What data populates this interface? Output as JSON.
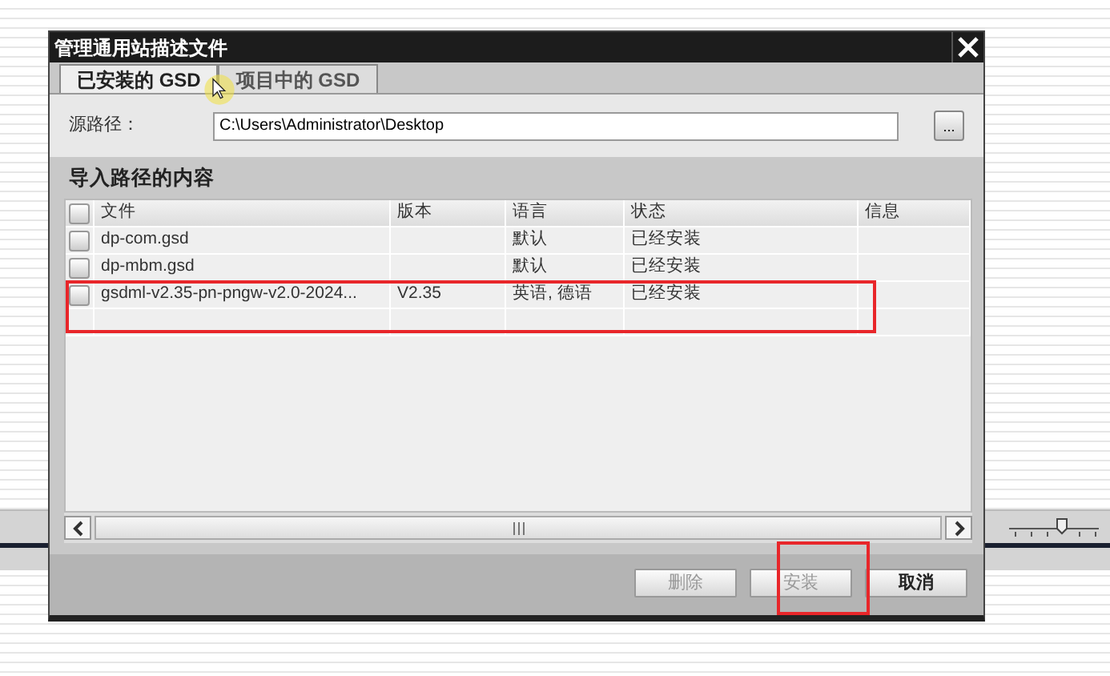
{
  "window": {
    "title": "管理通用站描述文件"
  },
  "tabs": [
    {
      "label": "已安装的 GSD",
      "selected": true
    },
    {
      "label": "项目中的 GSD",
      "selected": false
    }
  ],
  "source_path": {
    "label": "源路径：",
    "value": "C:\\Users\\Administrator\\Desktop",
    "browse_button": "..."
  },
  "section_title": "导入路径的内容",
  "table": {
    "header_checked": false,
    "columns": [
      "文件",
      "版本",
      "语言",
      "状态",
      "信息"
    ],
    "rows": [
      {
        "checked": false,
        "highlighted": false,
        "cells": [
          "dp-com.gsd",
          "",
          "默认",
          "已经安装",
          ""
        ]
      },
      {
        "checked": false,
        "highlighted": false,
        "cells": [
          "dp-mbm.gsd",
          "",
          "默认",
          "已经安装",
          ""
        ]
      },
      {
        "checked": false,
        "highlighted": true,
        "cells": [
          "gsdml-v2.35-pn-pngw-v2.0-2024...",
          "V2.35",
          "英语, 德语",
          "已经安装",
          ""
        ]
      }
    ]
  },
  "buttons": [
    {
      "label": "删除",
      "disabled": true,
      "highlighted": false,
      "bold": false
    },
    {
      "label": "安装",
      "disabled": true,
      "highlighted": true,
      "bold": false
    },
    {
      "label": "取消",
      "disabled": false,
      "highlighted": false,
      "bold": true
    }
  ]
}
